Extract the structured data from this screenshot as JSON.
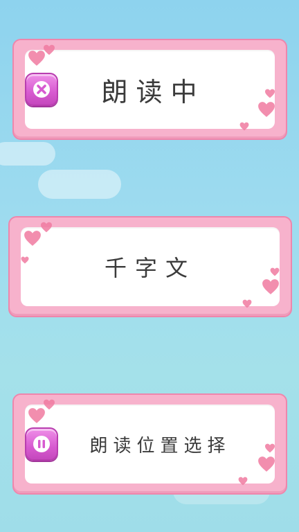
{
  "cards": [
    {
      "label": "朗读中",
      "icon": "close-icon"
    },
    {
      "label": "千字文"
    },
    {
      "label": "朗读位置选择",
      "icon": "pause-icon"
    }
  ],
  "colors": {
    "frame": "#f7b2cc",
    "frame_border": "#ee86ac",
    "button": "#d75ad0",
    "heart": "#f07aa0",
    "text": "#3b3b3b"
  }
}
